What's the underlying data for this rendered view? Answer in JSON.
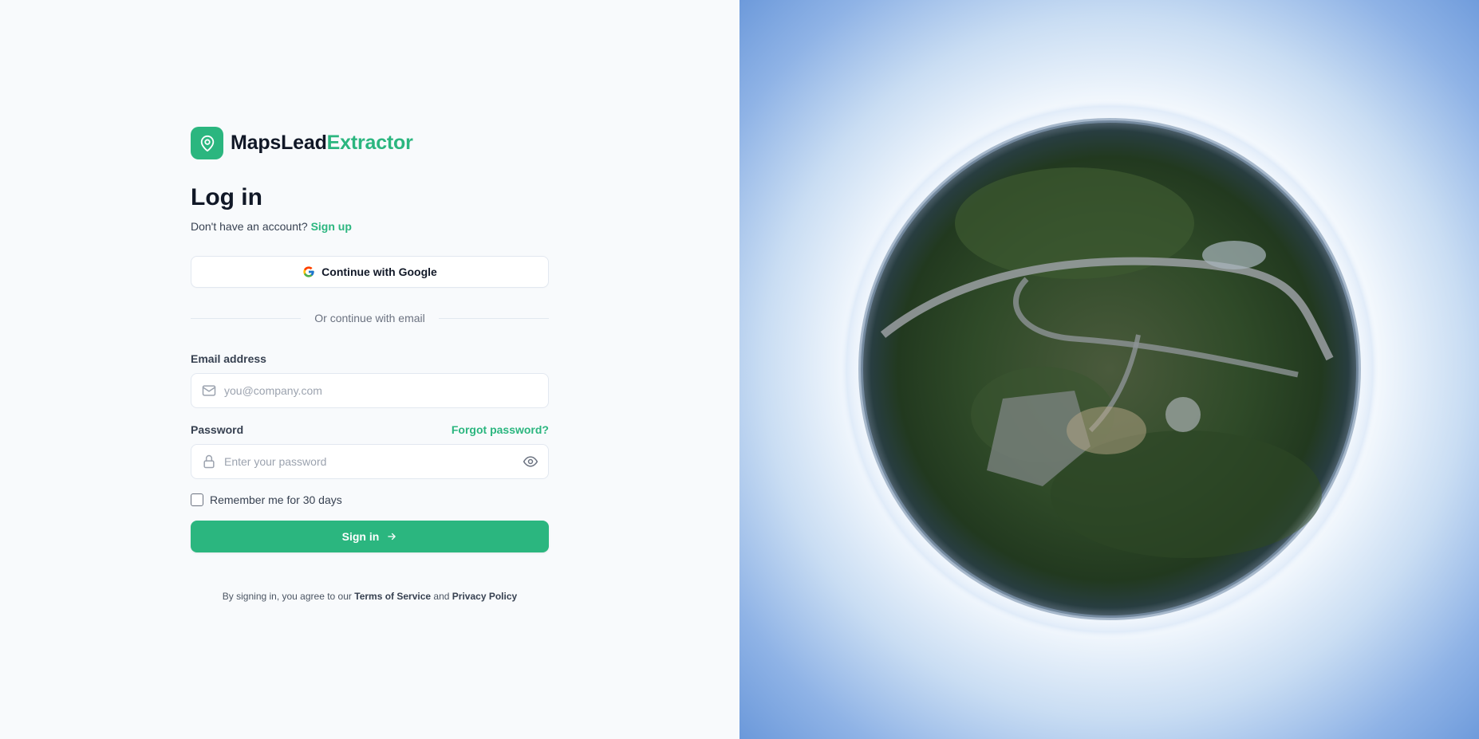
{
  "brand": {
    "name_part1": "MapsLead",
    "name_part2": "Extractor",
    "logo_icon": "map-pin-icon",
    "accent_color": "#2bb67f"
  },
  "login": {
    "title": "Log in",
    "no_account_text": "Don't have an account?",
    "signup_label": "Sign up",
    "google_button_label": "Continue with Google",
    "divider_text": "Or continue with email",
    "email": {
      "label": "Email address",
      "placeholder": "you@company.com",
      "value": ""
    },
    "password": {
      "label": "Password",
      "placeholder": "Enter your password",
      "value": "",
      "forgot_label": "Forgot password?"
    },
    "remember_label": "Remember me for 30 days",
    "remember_checked": false,
    "signin_label": "Sign in",
    "legal": {
      "prefix": "By signing in, you agree to our",
      "terms": "Terms of Service",
      "and": "and",
      "privacy": "Privacy Policy"
    }
  },
  "hero": {
    "image": "little-planet-aerial-photo"
  }
}
